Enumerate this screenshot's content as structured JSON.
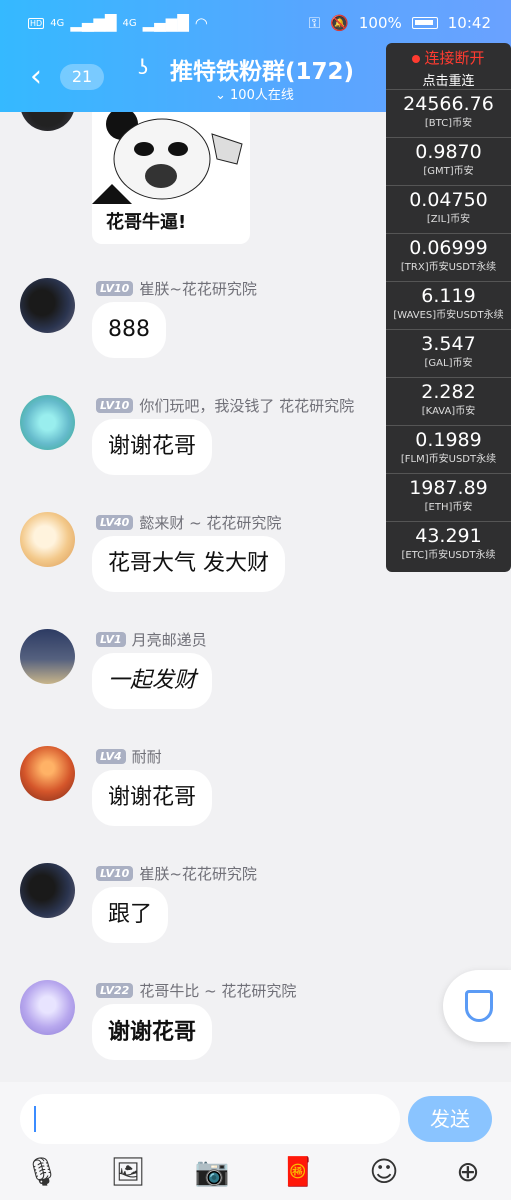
{
  "status": {
    "signal_left": "4G",
    "signal_right": "4G",
    "battery": "100%",
    "time": "10:42"
  },
  "header": {
    "back_icon": "‹",
    "unread_count": "21",
    "title": "推特铁粉群(172)",
    "online": "100人在线"
  },
  "ticker": {
    "disconnected": "连接断开",
    "retry": "点击重连",
    "items": [
      {
        "price": "24566.76",
        "symbol": "[BTC]币安"
      },
      {
        "price": "0.9870",
        "symbol": "[GMT]币安"
      },
      {
        "price": "0.04750",
        "symbol": "[ZIL]币安"
      },
      {
        "price": "0.06999",
        "symbol": "[TRX]币安USDT永续"
      },
      {
        "price": "6.119",
        "symbol": "[WAVES]币安USDT永续"
      },
      {
        "price": "3.547",
        "symbol": "[GAL]币安"
      },
      {
        "price": "2.282",
        "symbol": "[KAVA]币安"
      },
      {
        "price": "0.1989",
        "symbol": "[FLM]币安USDT永续"
      },
      {
        "price": "1987.89",
        "symbol": "[ETH]币安"
      },
      {
        "price": "43.291",
        "symbol": "[ETC]币安USDT永续"
      }
    ]
  },
  "sticker": {
    "caption": "花哥牛逼!"
  },
  "messages": [
    {
      "level": "LV10",
      "name": "崔朕~花花研究院",
      "text": "888"
    },
    {
      "level": "LV10",
      "name": "你们玩吧，我没钱了 花花研究院",
      "text": "谢谢花哥"
    },
    {
      "level": "LV40",
      "name": "懿来财 ~ 花花研究院",
      "text": "花哥大气 发大财"
    },
    {
      "level": "LV1",
      "name": "月亮邮递员",
      "text": "一起发财"
    },
    {
      "level": "LV4",
      "name": "耐耐",
      "text": "谢谢花哥"
    },
    {
      "level": "LV10",
      "name": "崔朕~花花研究院",
      "text": "跟了"
    },
    {
      "level": "LV22",
      "name": "花哥牛比 ~ 花花研究院",
      "text": "谢谢花哥"
    }
  ],
  "input": {
    "placeholder": "",
    "send_label": "发送"
  }
}
